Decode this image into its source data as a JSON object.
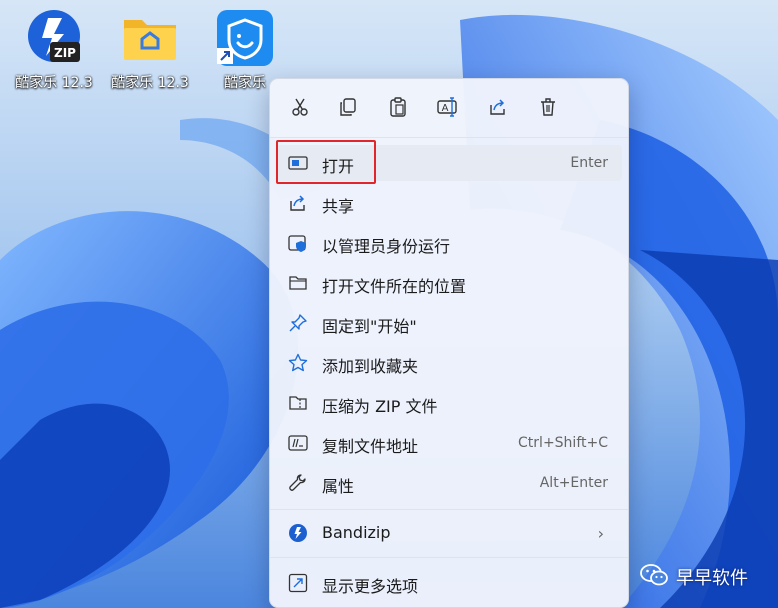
{
  "desktop": {
    "icons": [
      {
        "label": "酷家乐 12.3",
        "icon": "zip-installer-icon"
      },
      {
        "label": "酷家乐 12.3",
        "icon": "folder-icon"
      },
      {
        "label": "酷家乐",
        "icon": "app-shortcut-icon"
      }
    ]
  },
  "context_menu": {
    "toolbar": [
      {
        "name": "cut",
        "icon": "scissors-icon"
      },
      {
        "name": "copy",
        "icon": "copy-icon"
      },
      {
        "name": "paste",
        "icon": "clipboard-icon"
      },
      {
        "name": "rename",
        "icon": "rename-icon"
      },
      {
        "name": "share",
        "icon": "share-icon"
      },
      {
        "name": "delete",
        "icon": "trash-icon"
      }
    ],
    "items": [
      {
        "label": "打开",
        "shortcut": "Enter",
        "icon": "window-icon",
        "highlighted": true
      },
      {
        "label": "共享",
        "shortcut": "",
        "icon": "share-icon"
      },
      {
        "label": "以管理员身份运行",
        "shortcut": "",
        "icon": "shield-icon"
      },
      {
        "label": "打开文件所在的位置",
        "shortcut": "",
        "icon": "folder-icon"
      },
      {
        "label": "固定到\"开始\"",
        "shortcut": "",
        "icon": "pin-icon"
      },
      {
        "label": "添加到收藏夹",
        "shortcut": "",
        "icon": "star-icon"
      },
      {
        "label": "压缩为 ZIP 文件",
        "shortcut": "",
        "icon": "zip-folder-icon"
      },
      {
        "label": "复制文件地址",
        "shortcut": "Ctrl+Shift+C",
        "icon": "path-icon"
      },
      {
        "label": "属性",
        "shortcut": "Alt+Enter",
        "icon": "wrench-icon"
      },
      {
        "label": "Bandizip",
        "shortcut": "",
        "icon": "bandizip-icon",
        "submenu": true
      },
      {
        "label": "显示更多选项",
        "shortcut": "",
        "icon": "expand-icon"
      }
    ]
  },
  "watermark": {
    "text": "早早软件",
    "icon": "wechat-icon"
  },
  "colors": {
    "accent": "#1e6fd9",
    "highlight_box": "#e0262a",
    "menu_bg": "#f0f4fc"
  }
}
